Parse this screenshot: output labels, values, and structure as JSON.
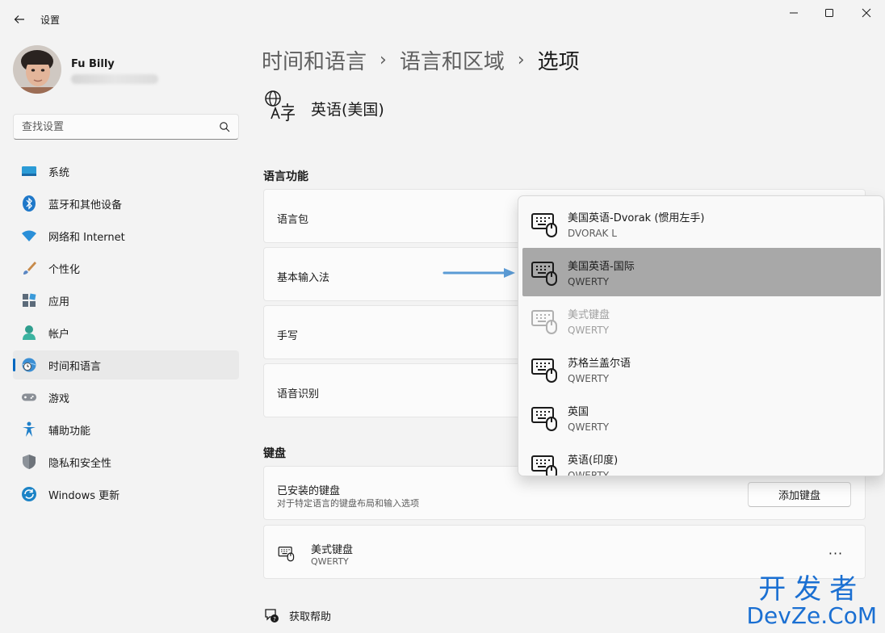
{
  "window": {
    "title": "设置"
  },
  "profile": {
    "name": "Fu Billy"
  },
  "search": {
    "placeholder": "查找设置"
  },
  "nav": {
    "items": [
      {
        "label": "系统",
        "icon": "system-monitor-icon",
        "active": false
      },
      {
        "label": "蓝牙和其他设备",
        "icon": "bluetooth-icon",
        "active": false
      },
      {
        "label": "网络和 Internet",
        "icon": "wifi-icon",
        "active": false
      },
      {
        "label": "个性化",
        "icon": "paintbrush-icon",
        "active": false
      },
      {
        "label": "应用",
        "icon": "apps-icon",
        "active": false
      },
      {
        "label": "帐户",
        "icon": "account-icon",
        "active": false
      },
      {
        "label": "时间和语言",
        "icon": "globe-clock-icon",
        "active": true
      },
      {
        "label": "游戏",
        "icon": "gamepad-icon",
        "active": false
      },
      {
        "label": "辅助功能",
        "icon": "accessibility-icon",
        "active": false
      },
      {
        "label": "隐私和安全性",
        "icon": "shield-icon",
        "active": false
      },
      {
        "label": "Windows 更新",
        "icon": "update-icon",
        "active": false
      }
    ]
  },
  "breadcrumb": {
    "items": [
      "时间和语言",
      "语言和区域"
    ],
    "current": "选项",
    "separator": "›"
  },
  "language": {
    "title": "英语(美国)"
  },
  "language_features": {
    "title": "语言功能",
    "rows": [
      "语言包",
      "基本输入法",
      "手写",
      "语音识别"
    ]
  },
  "keyboard": {
    "title": "键盘",
    "installed_title": "已安装的键盘",
    "installed_desc": "对于特定语言的键盘布局和输入选项",
    "add_button": "添加键盘",
    "installed_items": [
      {
        "name": "美式键盘",
        "sub": "QWERTY"
      }
    ],
    "more_label": "···"
  },
  "help": {
    "label": "获取帮助"
  },
  "dropdown": {
    "items": [
      {
        "name": "美国英语-Dvorak (惯用左手)",
        "sub": "DVORAK L",
        "state": "normal"
      },
      {
        "name": "美国英语-国际",
        "sub": "QWERTY",
        "state": "highlight"
      },
      {
        "name": "美式键盘",
        "sub": "QWERTY",
        "state": "disabled"
      },
      {
        "name": "苏格兰盖尔语",
        "sub": "QWERTY",
        "state": "normal"
      },
      {
        "name": "英国",
        "sub": "QWERTY",
        "state": "normal"
      },
      {
        "name": "英语(印度)",
        "sub": "QWERTY",
        "state": "normal"
      }
    ]
  },
  "watermark": {
    "line1": "开发者",
    "line2": "DevZe.CoM"
  },
  "colors": {
    "accent": "#0067c0",
    "highlight": "#a8a8a8",
    "arrow": "#5b9bd5",
    "watermark": "#1a6fd2"
  }
}
